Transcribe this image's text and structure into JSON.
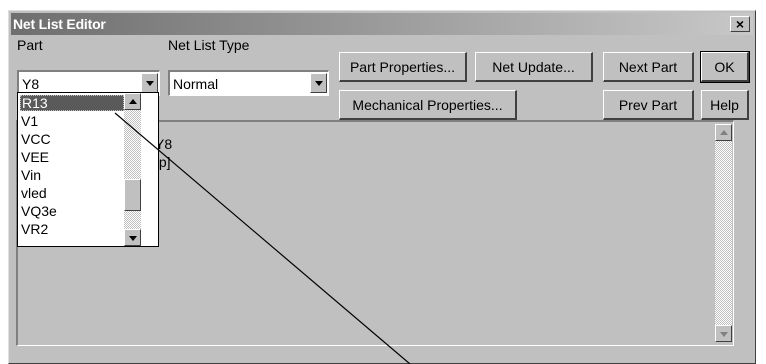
{
  "window": {
    "title": "Net List Editor",
    "close_label": "×"
  },
  "labels": {
    "part": "Part",
    "net_list_type": "Net List Type"
  },
  "part_combo": {
    "value": "Y8"
  },
  "type_combo": {
    "value": "Normal"
  },
  "buttons": {
    "part_properties": "Part Properties...",
    "net_update": "Net Update...",
    "next_part": "Next Part",
    "ok": "OK",
    "mechanical_properties": "Mechanical Properties...",
    "prev_part": "Prev Part",
    "help": "Help"
  },
  "part_list": {
    "items": [
      "R13",
      "V1",
      "VCC",
      "VEE",
      "Vin",
      "vled",
      "VQ3e",
      "VR2"
    ],
    "selected_index": 0
  },
  "netlist_content": {
    "line1": "Y8",
    "line2": "[p]"
  }
}
